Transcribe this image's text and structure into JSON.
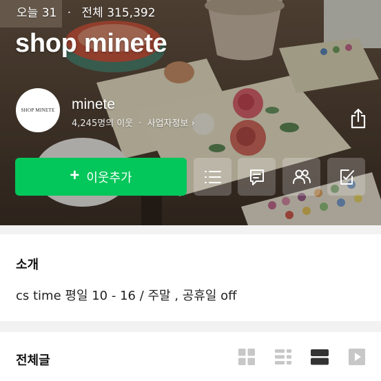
{
  "stats": {
    "today_label": "오늘",
    "today_count": "31",
    "separator": "·",
    "total_label": "전체",
    "total_count": "315,392"
  },
  "blog": {
    "title": "shop minete",
    "avatar_text": "SHOP MINETE",
    "nickname": "minete",
    "neighbor_count": "4,245명의 이웃",
    "business_info": "사업자정보"
  },
  "actions": {
    "add_neighbor_label": "이웃추가",
    "icons": [
      "list-icon",
      "chat-icon",
      "people-icon",
      "check-edit-icon"
    ],
    "share_icon": "share-icon"
  },
  "intro": {
    "heading": "소개",
    "text": "cs time 평일 10 - 16 / 주말 , 공휴일 off"
  },
  "posts": {
    "heading": "전체글",
    "view_modes": [
      "grid-view-icon",
      "list-view-icon",
      "card-view-icon",
      "video-view-icon"
    ],
    "active_view": "card-view-icon"
  },
  "colors": {
    "accent_green": "#03c75a",
    "active_icon": "#333333",
    "inactive_icon": "#c7c7c7"
  }
}
